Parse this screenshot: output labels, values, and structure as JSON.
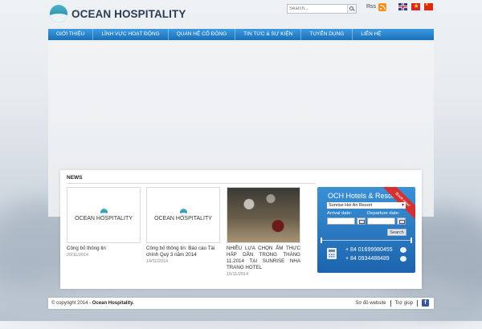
{
  "header": {
    "logo_text": "OCEAN HOSPITALITY",
    "search_placeholder": "Search...",
    "rss_label": "Rss",
    "languages": [
      "English",
      "Tiếng Việt",
      "中文"
    ]
  },
  "nav": {
    "items": [
      {
        "label": "GIỚI THIỆU"
      },
      {
        "label": "LĨNH VỰC HOẠT ĐỘNG"
      },
      {
        "label": "QUAN HỆ CỔ ĐÔNG"
      },
      {
        "label": "TIN TỨC & SỰ KIỆN"
      },
      {
        "label": "TUYỂN DỤNG"
      },
      {
        "label": "LIÊN HỆ"
      }
    ]
  },
  "news": {
    "title": "NEWS",
    "items": [
      {
        "logo_text": "OCEAN HOSPITALITY",
        "caption": "Công bố thông tin",
        "date": "20/11/2014"
      },
      {
        "logo_text": "OCEAN HOSPITALITY",
        "caption": "Công bố thông tin: Báo cáo Tài chính Quý 3 năm 2014",
        "date": "14/11/2014"
      },
      {
        "caption": "NHIỀU LỰA CHỌN ẨM THỰC HẤP DẪN TRONG THÁNG 11.2014 TẠI SUNRISE NHA TRANG HOTEL",
        "date": "10/11/2014"
      }
    ]
  },
  "booking": {
    "title": "OCH Hotels & Resort",
    "ribbon": "Book now!",
    "selected_hotel": "Sunrise Hoi An Resort",
    "arrival_label": "Arrival date:",
    "departure_label": "Departure date:",
    "search_label": "Search",
    "hotlines": [
      "+ 84 01699980455",
      "+ 84 0934488489"
    ]
  },
  "footer": {
    "copyright_prefix": "© copyright 2014 - ",
    "copyright_brand": "Ocean Hospitality.",
    "links": [
      "Sơ đồ website",
      "Trợ giúp"
    ]
  },
  "colors": {
    "nav_blue": "#1b6fb8",
    "booking_blue": "#2a7bc4",
    "ribbon_red": "#d63031",
    "brand_dark": "#2a3d52"
  }
}
